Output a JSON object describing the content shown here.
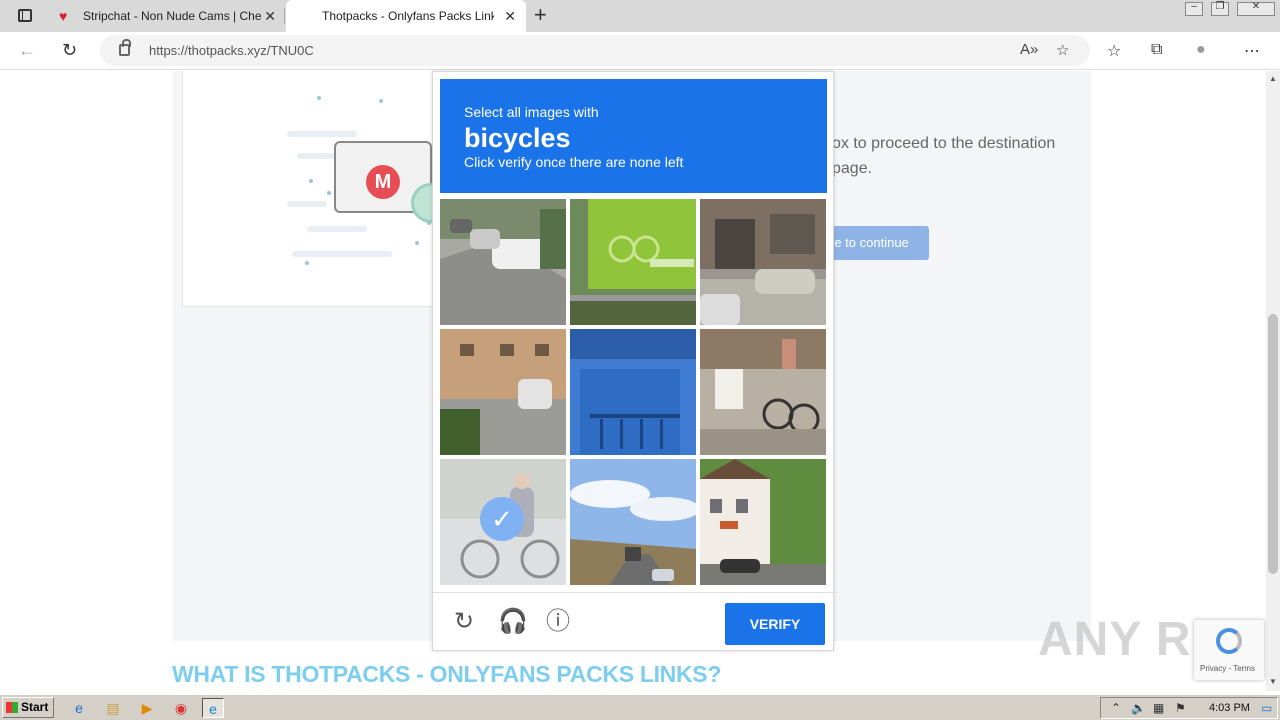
{
  "browser": {
    "tabs": [
      {
        "title": "Stripchat - Non Nude Cams | Che",
        "active": false
      },
      {
        "title": "Thotpacks - Onlyfans Packs Link",
        "active": true
      }
    ],
    "url_host": "https://thotpacks.xyz",
    "url_path": "/TNU0C"
  },
  "page": {
    "proceed_text": "ox to proceed to the destination page.",
    "continue_label": "re to continue",
    "section_title": "WHAT IS THOTPACKS - ONLYFANS PACKS LINKS?",
    "folder_letter": "M"
  },
  "captcha": {
    "instruction_line1": "Select all images with",
    "target": "bicycles",
    "instruction_line3": "Click verify once there are none left",
    "verify_label": "VERIFY",
    "tiles": [
      {
        "name": "street-cars",
        "selected": false
      },
      {
        "name": "bike-sign",
        "selected": false
      },
      {
        "name": "building-car",
        "selected": false
      },
      {
        "name": "apartment-car",
        "selected": false
      },
      {
        "name": "blue-balcony",
        "selected": false
      },
      {
        "name": "bikes-parked",
        "selected": false
      },
      {
        "name": "cyclist",
        "selected": true
      },
      {
        "name": "highway",
        "selected": false
      },
      {
        "name": "house-trees",
        "selected": false
      }
    ]
  },
  "recaptcha_badge": {
    "text": "Privacy - Terms"
  },
  "watermark": "ANY RUN",
  "taskbar": {
    "start_label": "Start",
    "clock": "4:03 PM"
  },
  "colors": {
    "accent": "#1a73e8",
    "section_title": "#7ccdf0"
  }
}
